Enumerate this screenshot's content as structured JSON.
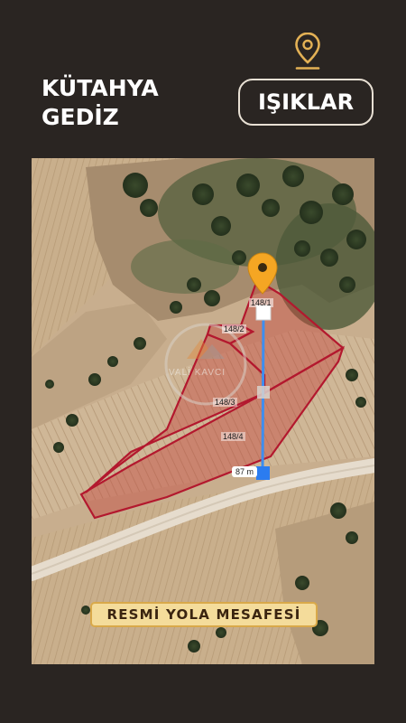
{
  "location": {
    "city": "KÜTAHYA",
    "district": "GEDİZ",
    "neighborhood": "IŞIKLAR"
  },
  "map": {
    "parcels": [
      "148/1",
      "148/2",
      "148/3",
      "148/4"
    ],
    "distance_label": "87 m",
    "watermark_text": "VALİ KAVCI",
    "parcel_color": "#b3182e",
    "route_color": "#3d8ef0",
    "marker_color": "#f5a623"
  },
  "banner": {
    "label": "RESMİ YOLA MESAFESİ"
  },
  "icons": {
    "header": "location-pin-icon",
    "map_marker": "map-marker-icon"
  },
  "colors": {
    "background": "#2a2522",
    "accent_gold": "#e3b155"
  }
}
